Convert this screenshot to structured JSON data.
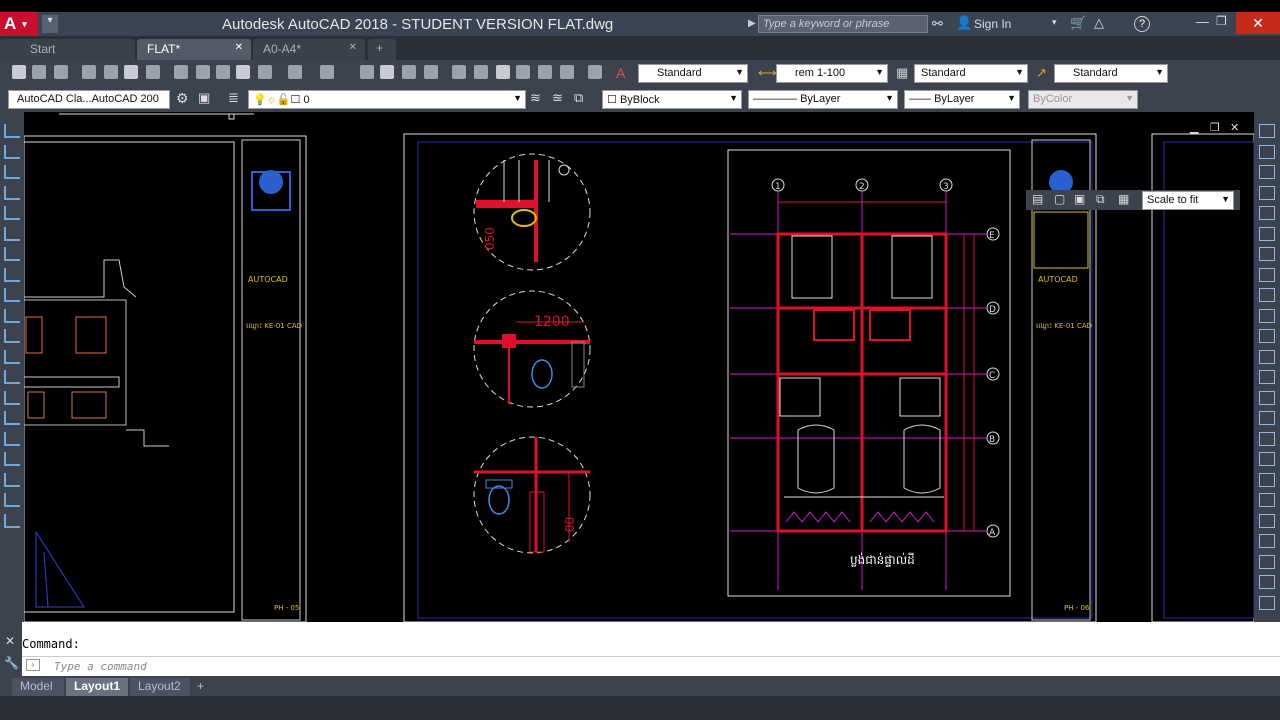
{
  "window": {
    "app_letter": "A",
    "title": "Autodesk AutoCAD 2018 - STUDENT VERSION    FLAT.dwg",
    "search_placeholder": "Type a keyword or phrase",
    "sign_in": "Sign In",
    "help": "?"
  },
  "tabs": [
    {
      "label": "Start"
    },
    {
      "label": "FLAT*"
    },
    {
      "label": "A0-A4*"
    },
    {
      "label": "+"
    }
  ],
  "toolbar": {
    "text_style": "Standard",
    "dim_style": "rem 1-100",
    "table_style": "Standard",
    "mleader_style": "Standard",
    "workspace": "AutoCAD Cla...AutoCAD 200",
    "layer": "0",
    "color": "ByBlock",
    "linetype": "ByLayer",
    "lineweight": "ByLayer",
    "plotstyle": "ByColor"
  },
  "viewport": {
    "scale": "Scale to fit"
  },
  "drawing": {
    "detail_dim_1200": "1200",
    "detail_dim_050": "050",
    "detail_dim_00": "00",
    "grid_cols": [
      "1",
      "2",
      "3"
    ],
    "grid_rows": [
      "E",
      "D",
      "C",
      "B",
      "A"
    ],
    "plan_caption": "ប្លង់ជាន់ផ្ទាល់ដី",
    "titleblock_code_left": "PH - 05",
    "titleblock_code_right": "PH - 06",
    "titleblock_sheet": "ឈ្មោះ KE-01 CAD",
    "titleblock_brand": "AUTOCAD"
  },
  "command": {
    "history": "Command:",
    "placeholder": "Type a command"
  },
  "layouts": [
    {
      "label": "Model"
    },
    {
      "label": "Layout1"
    },
    {
      "label": "Layout2"
    },
    {
      "label": "+"
    }
  ],
  "colors": {
    "accent_red": "#c8102e",
    "wall_red": "#e0102a",
    "grid_magenta": "#d81ad8",
    "viewport_blue": "#2430a8"
  }
}
